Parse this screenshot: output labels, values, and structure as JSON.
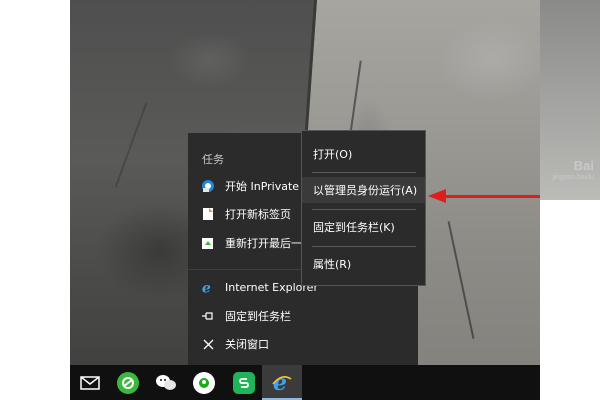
{
  "watermark": {
    "brand": "Bai",
    "sub": "jingyan.baidu"
  },
  "jumplist": {
    "section_title": "任务",
    "tasks": [
      {
        "label": "开始 InPrivate 浏",
        "icon": "ie-inprivate-icon"
      },
      {
        "label": "打开新标签页",
        "icon": "new-tab-icon"
      },
      {
        "label": "重新打开最后一",
        "icon": "reopen-session-icon"
      }
    ],
    "app_items": [
      {
        "label": "Internet Explorer",
        "icon": "ie-icon"
      },
      {
        "label": "固定到任务栏",
        "icon": "pin-icon"
      },
      {
        "label": "关闭窗口",
        "icon": "close-icon"
      }
    ]
  },
  "context_menu": {
    "items": [
      {
        "label": "打开(O)"
      },
      {
        "label": "以管理员身份运行(A)"
      },
      {
        "label": "固定到任务栏(K)"
      },
      {
        "label": "属性(R)"
      }
    ]
  },
  "taskbar": {
    "apps": [
      {
        "name": "mail-icon",
        "color": "#ffffff"
      },
      {
        "name": "360-browser-icon",
        "color": "#3cb83c"
      },
      {
        "name": "wechat-icon",
        "color": "#1aad19"
      },
      {
        "name": "qihoo-icon",
        "color": "#ffffff"
      },
      {
        "name": "wps-icon",
        "color": "#20b35a"
      },
      {
        "name": "ie-icon",
        "color": "#1d8ad8"
      }
    ]
  },
  "colors": {
    "arrow": "#e01d1d",
    "menu_bg": "#2b2b2b",
    "taskbar_bg": "#101010"
  }
}
